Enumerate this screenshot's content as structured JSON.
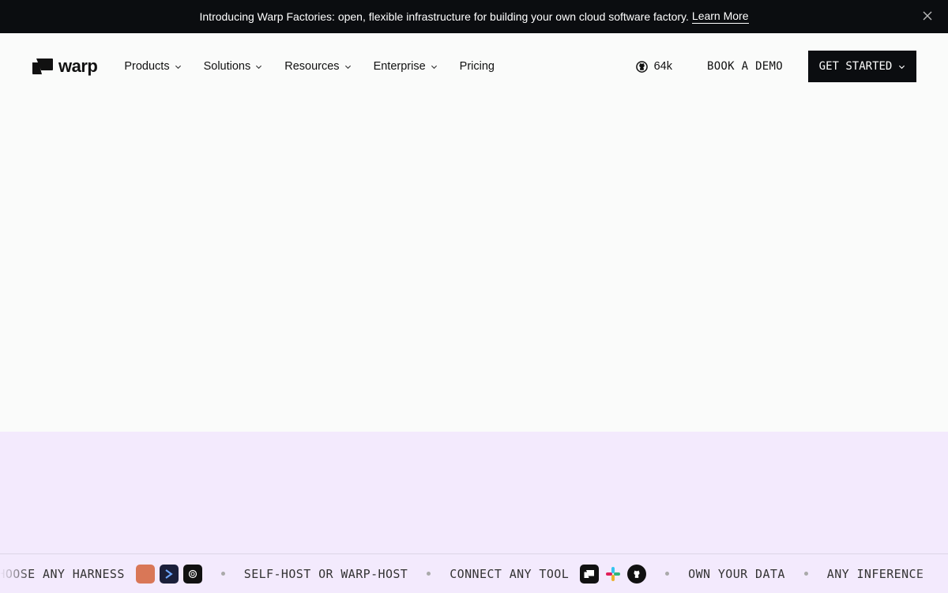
{
  "banner": {
    "message": "Introducing Warp Factories: open, flexible infrastructure for building your own cloud software factory.",
    "link_label": "Learn More"
  },
  "nav": {
    "logo_text": "warp",
    "menu": [
      {
        "label": "Products"
      },
      {
        "label": "Solutions"
      },
      {
        "label": "Resources"
      },
      {
        "label": "Enterprise"
      },
      {
        "label": "Pricing"
      }
    ],
    "github_stars": "64k",
    "book_demo": "BOOK A DEMO",
    "get_started": "GET STARTED"
  },
  "ticker": {
    "items": [
      "CHOOSE ANY HARNESS",
      "SELF-HOST OR WARP-HOST",
      "CONNECT ANY TOOL",
      "OWN YOUR DATA",
      "ANY INFERENCE"
    ]
  },
  "colors": {
    "banner_bg": "#0b0d10",
    "page_bg": "#fafbfa",
    "lavender": "#f3eafd",
    "harness_orange": "#d97757"
  }
}
